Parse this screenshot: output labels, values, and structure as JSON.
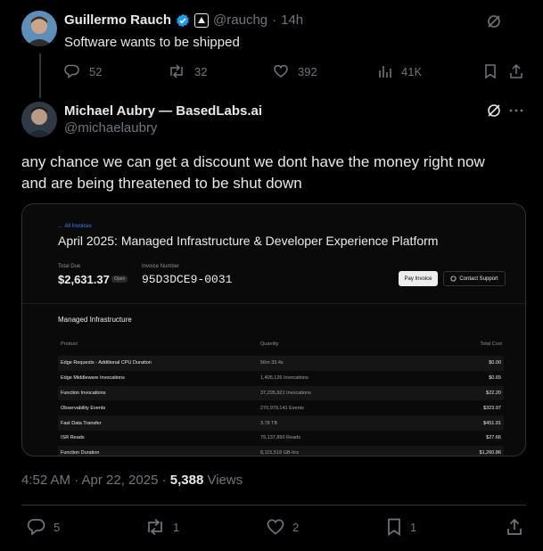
{
  "parent": {
    "author_name": "Guillermo Rauch",
    "handle": "@rauchg",
    "time": "14h",
    "text": "Software wants to be shipped",
    "replies": "52",
    "reposts": "32",
    "likes": "392",
    "views": "41K"
  },
  "main": {
    "author_name": "Michael Aubry — BasedLabs.ai",
    "handle": "@michaelaubry",
    "text_line1": "any chance we can get a discount we dont have the money right now",
    "text_line2": "and are being threatened to be shut down"
  },
  "invoice": {
    "back_link": "← All Invoices",
    "title": "April 2025: Managed Infrastructure & Developer Experience Platform",
    "total_due_label": "Total Due",
    "total_due_value": "$2,631.37",
    "status_badge": "Open",
    "invoice_number_label": "Invoice Number",
    "invoice_number_value": "95D3DCE9-0031",
    "pay_button": "Pay Invoice",
    "contact_button": "Contact Support",
    "section_title": "Managed Infrastructure",
    "columns": {
      "product": "Product",
      "quantity": "Quantity",
      "total": "Total Cost"
    },
    "rows": [
      {
        "product": "Edge Requests - Additional CPU Duration",
        "quantity": "56m 33.4s",
        "total": "$0.00"
      },
      {
        "product": "Edge Middleware Invocations",
        "quantity": "1,405,126 Invocations",
        "total": "$0.65"
      },
      {
        "product": "Function Invocations",
        "quantity": "37,295,921 Invocations",
        "total": "$22.20"
      },
      {
        "product": "Observability Events",
        "quantity": "270,979,141 Events",
        "total": "$323.97"
      },
      {
        "product": "Fast Data Transfer",
        "quantity": "3.78 TB",
        "total": "$451.91"
      },
      {
        "product": "ISR Reads",
        "quantity": "79,137,850 Reads",
        "total": "$27.66"
      },
      {
        "product": "Function Duration",
        "quantity": "8,115,518 GB-hrs",
        "total": "$1,260.86"
      }
    ]
  },
  "meta": {
    "time": "4:52 AM · Apr 22, 2025 · ",
    "views_count": "5,388",
    "views_label": " Views"
  },
  "actions": {
    "replies": "5",
    "reposts": "1",
    "likes": "2",
    "bookmarks": "1"
  },
  "colors": {
    "background": "#000000",
    "text": "#e7e9ea",
    "muted": "#71767b",
    "verified": "#1d9bf0",
    "link": "#3b82f6"
  },
  "icons": {
    "grok": "grok-icon",
    "reply": "reply-icon",
    "repost": "repost-icon",
    "like": "heart-icon",
    "views": "views-icon",
    "bookmark": "bookmark-icon",
    "share": "share-icon",
    "verified": "verified-badge-icon"
  }
}
